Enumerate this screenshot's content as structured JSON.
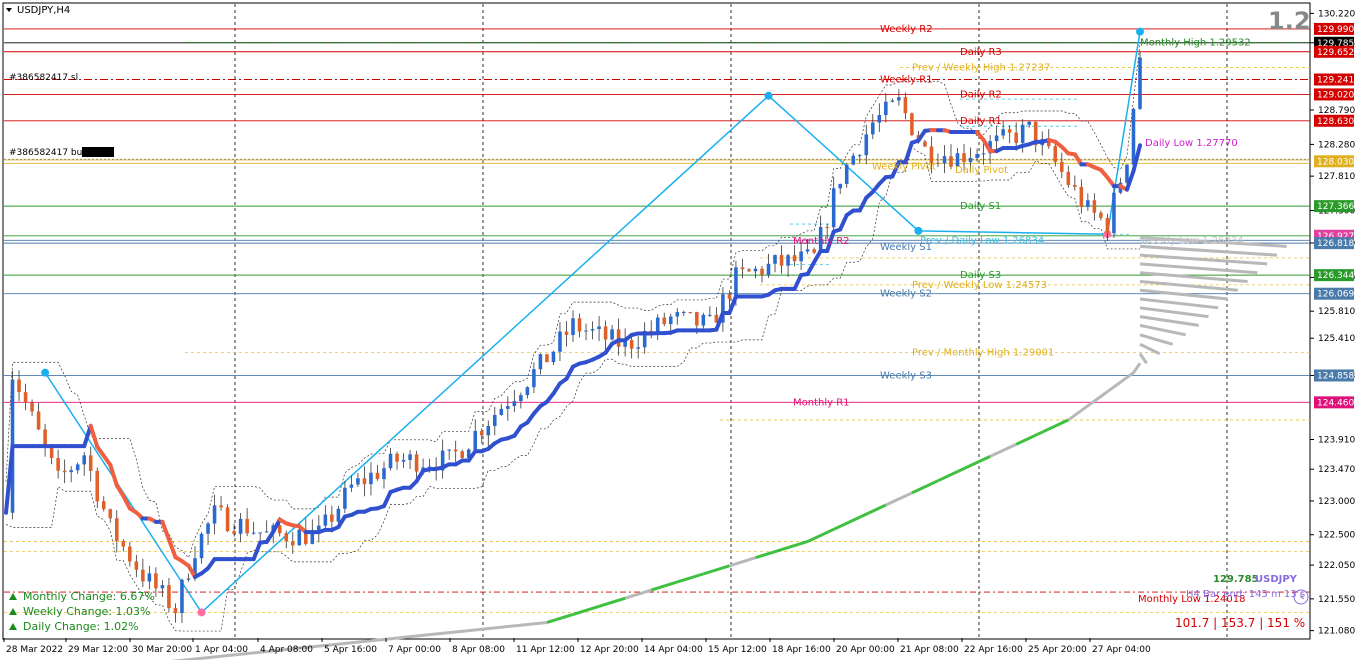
{
  "window": {
    "symbol_title": "USDJPY,H4",
    "version_badge": "1.2"
  },
  "orders": [
    {
      "label": "#386582417 sl"
    },
    {
      "label": "#386582417 buy"
    }
  ],
  "chart_data": {
    "type": "candlestick",
    "symbol": "USDJPY",
    "timeframe": "H4",
    "ylim": [
      121.0,
      130.3
    ],
    "price_ticks": [
      "130.220",
      "129.785",
      "128.790",
      "128.280",
      "127.810",
      "127.300",
      "126.820",
      "126.310",
      "125.810",
      "125.410",
      "124.858",
      "123.910",
      "123.470",
      "123.000",
      "122.500",
      "122.050",
      "121.550",
      "121.080"
    ],
    "price_tags": [
      {
        "value": "129.990",
        "color": "#d40000"
      },
      {
        "value": "129.785",
        "color": "#000000"
      },
      {
        "value": "129.652",
        "color": "#d40000"
      },
      {
        "value": "129.241",
        "color": "#d40000"
      },
      {
        "value": "129.020",
        "color": "#d40000"
      },
      {
        "value": "128.630",
        "color": "#d40000"
      },
      {
        "value": "128.030",
        "color": "#e0b020"
      },
      {
        "value": "127.366",
        "color": "#2a9a2a"
      },
      {
        "value": "126.927",
        "color": "#e040a0"
      },
      {
        "value": "126.818",
        "color": "#4a7aaa"
      },
      {
        "value": "126.344",
        "color": "#2a9a2a"
      },
      {
        "value": "126.069",
        "color": "#4a7aaa"
      },
      {
        "value": "124.858",
        "color": "#4a7aaa"
      },
      {
        "value": "124.460",
        "color": "#e0107a"
      }
    ],
    "time_labels": [
      "28 Mar 2022",
      "29 Mar 12:00",
      "30 Mar 20:00",
      "1 Apr 04:00",
      "4 Apr 08:00",
      "5 Apr 16:00",
      "7 Apr 00:00",
      "8 Apr 08:00",
      "11 Apr 12:00",
      "12 Apr 20:00",
      "14 Apr 04:00",
      "15 Apr 12:00",
      "18 Apr 16:00",
      "20 Apr 00:00",
      "21 Apr 08:00",
      "22 Apr 16:00",
      "25 Apr 20:00",
      "27 Apr 04:00"
    ],
    "levels": [
      {
        "name": "Weekly R2",
        "price": 129.99,
        "color": "#d40000",
        "label_pos": "center"
      },
      {
        "name": "Monthly High 1.29532",
        "price": 129.79,
        "color": "#2a8a2a",
        "label_pos": "right"
      },
      {
        "name": "Daily R3",
        "price": 129.652,
        "color": "#d40000",
        "label_pos": "center2"
      },
      {
        "name": "Prev / Weekly High 1.27237",
        "price": 129.42,
        "color": "#e0b020",
        "label_pos": "center"
      },
      {
        "name": "Weekly R1",
        "price": 129.241,
        "color": "#d40000",
        "label_pos": "center"
      },
      {
        "name": "Daily R2",
        "price": 129.02,
        "color": "#d40000",
        "label_pos": "center2"
      },
      {
        "name": "Daily R1",
        "price": 128.63,
        "color": "#d40000",
        "label_pos": "center2"
      },
      {
        "name": "Daily Low 1.27770",
        "price": 128.3,
        "color": "#d020d0",
        "label_pos": "right"
      },
      {
        "name": "Weekly Pivot",
        "price": 127.95,
        "color": "#e0b020",
        "label_pos": "center"
      },
      {
        "name": "Daily Pivot",
        "price": 127.9,
        "color": "#e0b020",
        "label_pos": "center2"
      },
      {
        "name": "Daily S1",
        "price": 127.366,
        "color": "#2a9a2a",
        "label_pos": "center2"
      },
      {
        "name": "Monthly R2",
        "price": 126.85,
        "color": "#e0107a",
        "label_pos": "left"
      },
      {
        "name": "Prev / Daily Low 1.26834",
        "price": 126.86,
        "color": "#40c0e0",
        "label_pos": "center2"
      },
      {
        "name": "Weekly S1",
        "price": 126.76,
        "color": "#4a7aaa",
        "label_pos": "center"
      },
      {
        "name": "Daily S3",
        "price": 126.344,
        "color": "#2a9a2a",
        "label_pos": "center2"
      },
      {
        "name": "Prev / Weekly Low 1.24573",
        "price": 126.2,
        "color": "#e0b020",
        "label_pos": "center2"
      },
      {
        "name": "Weekly S2",
        "price": 126.069,
        "color": "#4a7aaa",
        "label_pos": "center"
      },
      {
        "name": "Prev / Monthly High 1.29001",
        "price": 125.2,
        "color": "#e0b020",
        "label_pos": "center"
      },
      {
        "name": "Weekly S3",
        "price": 124.858,
        "color": "#4a7aaa",
        "label_pos": "center"
      },
      {
        "name": "Monthly R1",
        "price": 124.46,
        "color": "#e0107a",
        "label_pos": "left"
      },
      {
        "name": "Weekly Low 1.26834",
        "price": 126.86,
        "color": "#c8c8c8",
        "label_pos": "right"
      },
      {
        "name": "Monthly Low 1.24018",
        "price": 121.65,
        "color": "#d40000",
        "label_pos": "right"
      }
    ],
    "stats": {
      "monthly_change": "Monthly Change: 6.67%",
      "weekly_change": "Weekly Change: 1.03%",
      "daily_change": "Daily Change: 1.02%",
      "bid": "129.785",
      "symbol": "USDJPY",
      "bar_end": "H4 Bar end: 145 m 13 s",
      "ranges": "101.7 | 153.7 | 151 %"
    }
  }
}
